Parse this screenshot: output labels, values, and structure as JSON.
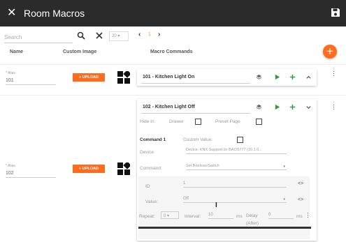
{
  "header": {
    "title": "Room Macros"
  },
  "toolbar": {
    "search_placeholder": "Search",
    "page_size": "20",
    "page": "1"
  },
  "columns": {
    "name": "Name",
    "image": "Custom Image",
    "commands": "Macro Commands"
  },
  "macros": [
    {
      "alias_label": "* Alias",
      "alias": "101",
      "upload_label": "+ UPLOAD",
      "title": "101 - Kitchen Light On"
    },
    {
      "alias_label": "* Alias",
      "alias": "102",
      "upload_label": "+ UPLOAD",
      "title": "102 - Kitchen Light Off",
      "hide_in_label": "Hide In:",
      "drawer_label": "Drawer",
      "preset_page_label": "Preset Page",
      "command_label": "Command 1",
      "custom_value_label": "Custom Value:",
      "device_label": "Device:",
      "device_value": "Device: KNX Support on BAOS777 (10.1.0...",
      "command_field_label": "Command:",
      "command_value": "Set Boolean/Switch",
      "id_label": "ID",
      "id_value": "1",
      "value_label": "Value:",
      "value_value": "Off",
      "code_glyph": "<>",
      "repeat_label": "Repeat:",
      "repeat_value": "0",
      "interval_label": "Interval:",
      "interval_value": "10",
      "interval_unit": "ms",
      "delay_label": "Delay",
      "delay_sublabel": "(After)",
      "delay_value": "0",
      "delay_unit": "ms"
    }
  ],
  "colors": {
    "header_bg": "#2b2b2b",
    "accent": "#ff6b1f",
    "play_green": "#2e9a3a"
  }
}
